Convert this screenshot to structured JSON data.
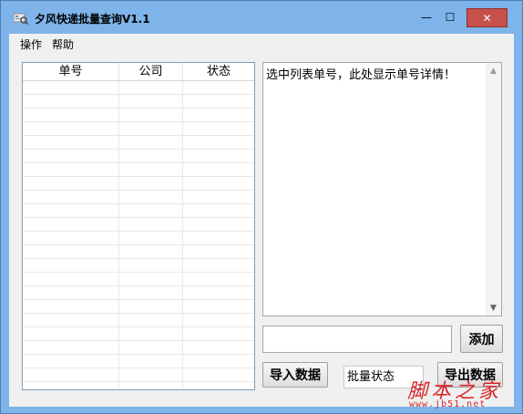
{
  "window": {
    "title": "夕风快递批量查询V1.1",
    "minimize_glyph": "—",
    "maximize_glyph": "☐",
    "close_glyph": "✕"
  },
  "menu": {
    "items": [
      {
        "label": "操作"
      },
      {
        "label": "帮助"
      }
    ]
  },
  "list": {
    "columns": [
      {
        "label": "单号"
      },
      {
        "label": "公司"
      },
      {
        "label": "状态"
      }
    ],
    "rows": []
  },
  "detail": {
    "text": "选中列表单号，此处显示单号详情！",
    "scroll_up_glyph": "▲",
    "scroll_down_glyph": "▼"
  },
  "add": {
    "input_value": "",
    "button_label": "添加"
  },
  "actions": {
    "import_label": "导入数据",
    "export_label": "导出数据",
    "status_value": "批量状态"
  },
  "watermark": {
    "brand": "脚本之家",
    "url": "www.jb51.net"
  },
  "colors": {
    "titlebar": "#7eb4ea",
    "close_button": "#c7504b",
    "client_bg": "#f0f0f0",
    "watermark": "#d8262a"
  },
  "icons": {
    "app_icon": "magnifier-icon"
  }
}
